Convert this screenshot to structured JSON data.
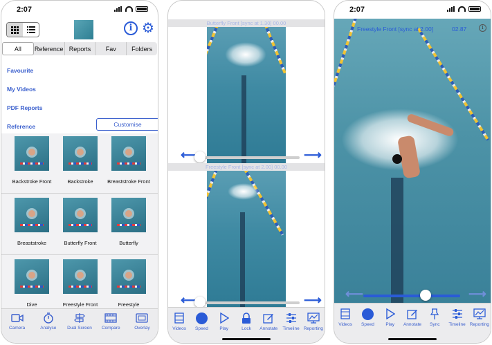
{
  "status": {
    "time": "2:07"
  },
  "phone1": {
    "toolbar": {
      "grid_icon": "grid-view-icon",
      "list_icon": "list-view-icon",
      "info_label": "i",
      "gear_icon": "gear-icon"
    },
    "segments": [
      "All",
      "Reference",
      "Reports",
      "Fav",
      "Folders"
    ],
    "active_segment": "All",
    "menu": [
      "Favourite",
      "My Videos",
      "PDF Reports",
      "Reference"
    ],
    "customise_label": "Customise",
    "tiles": [
      "Backstroke Front",
      "Backstroke",
      "Breaststroke Front",
      "Breaststroke",
      "Butterfly Front",
      "Butterfly",
      "Dive",
      "Freestyle Front",
      "Freestyle"
    ],
    "tabbar": [
      {
        "label": "Camera",
        "icon": "camera-icon"
      },
      {
        "label": "Analyse",
        "icon": "stopwatch-icon"
      },
      {
        "label": "Dual Screen",
        "icon": "signpost-icon"
      },
      {
        "label": "Compare",
        "icon": "film-icon"
      },
      {
        "label": "Overlay",
        "icon": "overlay-icon"
      }
    ]
  },
  "phone2": {
    "top_title": "Butterfly Front [sync at 1.30]  00.00",
    "bottom_title": "Freestyle Front [sync at 2.00]  00.00",
    "controls": [
      {
        "label": "Videos",
        "icon": "videos-icon"
      },
      {
        "label": "Speed",
        "icon": "speed-icon"
      },
      {
        "label": "Play",
        "icon": "play-icon"
      },
      {
        "label": "Lock",
        "icon": "lock-icon"
      },
      {
        "label": "Annotate",
        "icon": "annotate-icon"
      },
      {
        "label": "Timeline",
        "icon": "timeline-icon"
      },
      {
        "label": "Reporting",
        "icon": "reporting-icon"
      }
    ]
  },
  "phone3": {
    "title": "Freestyle Front [sync at 2.00]",
    "time": "02.87",
    "info_label": "i",
    "controls": [
      {
        "label": "Videos",
        "icon": "videos-icon"
      },
      {
        "label": "Speed",
        "icon": "speed-icon"
      },
      {
        "label": "Play",
        "icon": "play-icon"
      },
      {
        "label": "Annotate",
        "icon": "annotate-icon"
      },
      {
        "label": "Sync",
        "icon": "sync-pin-icon"
      },
      {
        "label": "Timeline",
        "icon": "timeline-icon"
      },
      {
        "label": "Reporting",
        "icon": "reporting-icon"
      }
    ]
  },
  "colors": {
    "accent": "#2a5bd7",
    "link": "#3a5fcd",
    "water": "#4d93a7"
  }
}
